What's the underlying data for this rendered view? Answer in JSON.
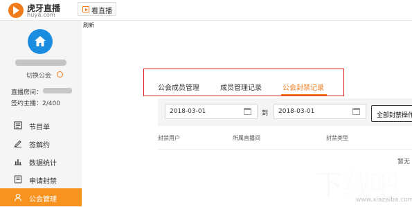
{
  "header": {
    "logo_name": "虎牙直播",
    "logo_domain": "huya.com",
    "watch_live_label": "看直播"
  },
  "sidebar": {
    "switch_guild_label": "切换公会",
    "room_label": "直播房间：",
    "signed_hosts_label": "签约主播：2/400",
    "menu": [
      {
        "label": "节目单",
        "icon": "list-icon",
        "active": false
      },
      {
        "label": "签解约",
        "icon": "pen-icon",
        "active": false
      },
      {
        "label": "数据统计",
        "icon": "bar-chart-icon",
        "active": false
      },
      {
        "label": "申请封禁",
        "icon": "document-icon",
        "active": false
      },
      {
        "label": "公会管理",
        "icon": "user-icon",
        "active": true
      }
    ]
  },
  "main": {
    "refresh_label": "刷新",
    "tabs": [
      {
        "label": "公会成员管理",
        "active": false
      },
      {
        "label": "成员管理记录",
        "active": false
      },
      {
        "label": "公会封禁记录",
        "active": true
      }
    ],
    "filter": {
      "start_date": "2018-03-01",
      "to_label": "到",
      "end_date": "2018-03-01",
      "operation_select": "全部封禁操作"
    },
    "table": {
      "columns": [
        "封禁用户",
        "所属直播间",
        "封禁类型"
      ],
      "empty_text": "暂无"
    }
  },
  "watermark": {
    "text": "下载吧",
    "domain": "www.xiazaiba.com"
  },
  "colors": {
    "accent": "#f07b1b",
    "active_menu_bg": "#f7931e",
    "highlight_box": "#e02020",
    "avatar_bg": "#1b8de0"
  }
}
